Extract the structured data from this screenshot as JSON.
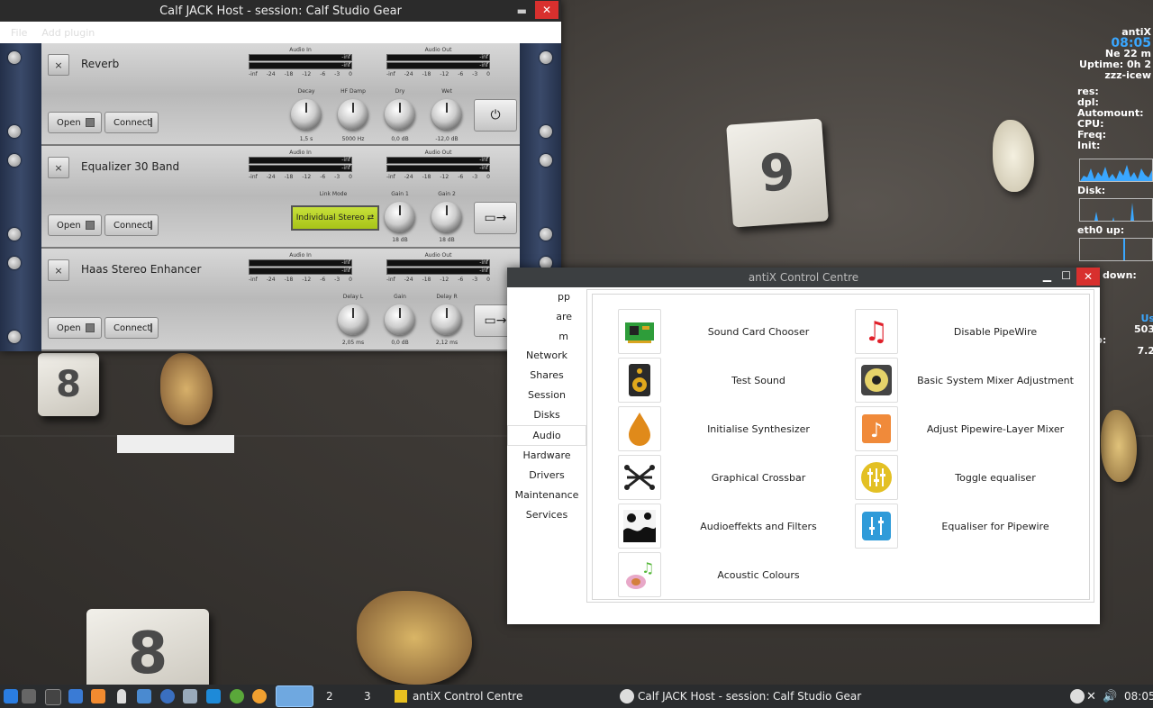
{
  "calf": {
    "title": "Calf JACK Host - session: Calf Studio Gear",
    "menu": [
      "File",
      "Add plugin"
    ],
    "plugins": [
      {
        "close": "×",
        "name": "Reverb",
        "open": "Open",
        "connect": "Connect",
        "audio_in": "Audio In",
        "audio_out": "Audio Out",
        "inf": "-inf",
        "scale": [
          "-inf",
          "-24",
          "-18",
          "-12",
          "-6",
          "-3",
          "0"
        ],
        "knobs": [
          {
            "label": "Decay",
            "value": "1,5 s"
          },
          {
            "label": "HF Damp",
            "value": "5000 Hz"
          },
          {
            "label": "Dry",
            "value": "0,0 dB"
          },
          {
            "label": "Wet",
            "value": "-12,0 dB"
          }
        ]
      },
      {
        "close": "×",
        "name": "Equalizer 30 Band",
        "open": "Open",
        "connect": "Connect",
        "audio_in": "Audio In",
        "audio_out": "Audio Out",
        "inf": "-inf",
        "scale": [
          "-inf",
          "-24",
          "-18",
          "-12",
          "-6",
          "-3",
          "0"
        ],
        "link_mode_label": "Link Mode",
        "link_mode_value": "Individual Stereo",
        "knobs": [
          {
            "label": "Gain 1",
            "value": "18 dB"
          },
          {
            "label": "Gain 2",
            "value": "18 dB"
          }
        ]
      },
      {
        "close": "×",
        "name": "Haas Stereo Enhancer",
        "open": "Open",
        "connect": "Connect",
        "audio_in": "Audio In",
        "audio_out": "Audio Out",
        "inf": "-inf",
        "scale": [
          "-inf",
          "-24",
          "-18",
          "-12",
          "-6",
          "-3",
          "0"
        ],
        "knobs": [
          {
            "label": "Delay L",
            "value": "2,05 ms"
          },
          {
            "label": "Gain",
            "value": "0,0 dB"
          },
          {
            "label": "Delay R",
            "value": "2,12 ms"
          }
        ]
      }
    ]
  },
  "acc": {
    "title": "antiX Control Centre",
    "sidebar": [
      "pp",
      "are",
      "m",
      "Network",
      "Shares",
      "Session",
      "Disks",
      "Audio",
      "Hardware",
      "Drivers",
      "Maintenance",
      "Services"
    ],
    "active": "Audio",
    "left_entries": [
      "Sound Card Chooser",
      "Test Sound",
      "Initialise Synthesizer",
      "Graphical Crossbar",
      "Audioeffekts and Filters",
      "Acoustic Colours"
    ],
    "right_entries": [
      "Disable PipeWire",
      "Basic System Mixer Adjustment",
      "Adjust Pipewire-Layer Mixer",
      "Toggle equaliser",
      "Equaliser for Pipewire"
    ]
  },
  "conky": {
    "name": "antiX",
    "time": "08:05",
    "date": "Ne 22 m",
    "uptime": "Uptime: 0h 2",
    "host": "zzz-icew",
    "labels": [
      "res:",
      "dpl:",
      "Automount:",
      "CPU:",
      "Freq:",
      "Init:"
    ],
    "disk": "Disk:",
    "eth_up": "eth0 up:",
    "eth_down": "down:",
    "us": "Us",
    "v1": "503",
    "v2": "7.2",
    "p1": "p:",
    "p2": ":"
  },
  "taskbar": {
    "workspaces": [
      "2",
      "3"
    ],
    "task1": "antiX Control Centre",
    "task2": "Calf JACK Host - session: Calf Studio Gear",
    "clock": "08:05"
  },
  "dice_labels": [
    "9",
    "8",
    "8"
  ]
}
